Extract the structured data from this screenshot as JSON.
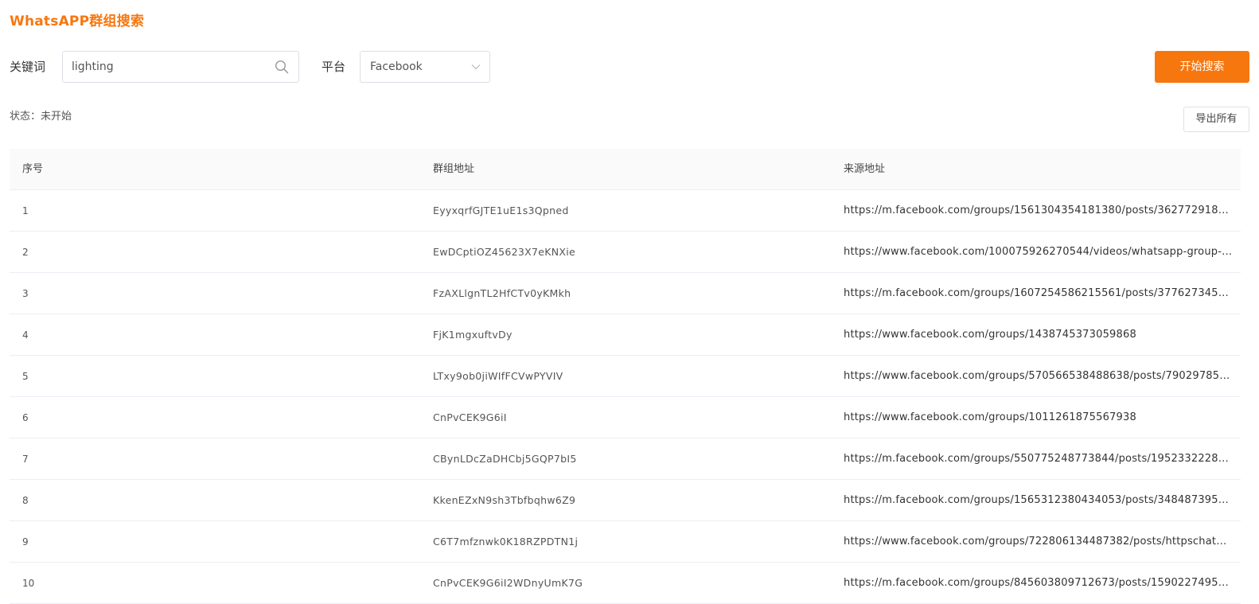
{
  "page_title": "WhatsAPP群组搜索",
  "colors": {
    "accent": "#f7770f",
    "border": "#dcdfe6",
    "header_bg": "#fafafa"
  },
  "search": {
    "keyword_label": "关键词",
    "keyword_value": "lighting",
    "platform_label": "平台",
    "platform_value": "Facebook",
    "start_button": "开始搜索",
    "search_icon": "search-icon",
    "dropdown_icon": "chevron-down-icon"
  },
  "status_text": "状态：未开始",
  "export_button": "导出所有",
  "table": {
    "columns": [
      "序号",
      "群组地址",
      "来源地址"
    ],
    "rows": [
      {
        "index": "1",
        "group": "EyyxqrfGJTE1uE1s3Qpned",
        "source": "https://m.facebook.com/groups/1561304354181380/posts/3627729180..."
      },
      {
        "index": "2",
        "group": "EwDCptiOZ45623X7eKNXie",
        "source": "https://www.facebook.com/100075926270544/videos/whatsapp-group-l..."
      },
      {
        "index": "3",
        "group": "FzAXLlgnTL2HfCTv0yKMkh",
        "source": "https://m.facebook.com/groups/1607254586215561/posts/3776273452..."
      },
      {
        "index": "4",
        "group": "FjK1mgxuftvDy",
        "source": "https://www.facebook.com/groups/1438745373059868"
      },
      {
        "index": "5",
        "group": "LTxy9ob0jiWIfFCVwPYVIV",
        "source": "https://www.facebook.com/groups/570566538488638/posts/790297856..."
      },
      {
        "index": "6",
        "group": "CnPvCEK9G6iI",
        "source": "https://www.facebook.com/groups/1011261875567938"
      },
      {
        "index": "7",
        "group": "CBynLDcZaDHCbj5GQP7bI5",
        "source": "https://m.facebook.com/groups/550775248773844/posts/19523322286..."
      },
      {
        "index": "8",
        "group": "KkenEZxN9sh3Tbfbqhw6Z9",
        "source": "https://m.facebook.com/groups/1565312380434053/posts/3484873958..."
      },
      {
        "index": "9",
        "group": "C6T7mfznwk0K18RZPDTN1j",
        "source": "https://www.facebook.com/groups/722806134487382/posts/httpschatw..."
      },
      {
        "index": "10",
        "group": "CnPvCEK9G6iI2WDnyUmK7G",
        "source": "https://m.facebook.com/groups/845603809712673/posts/15902274952..."
      }
    ]
  }
}
